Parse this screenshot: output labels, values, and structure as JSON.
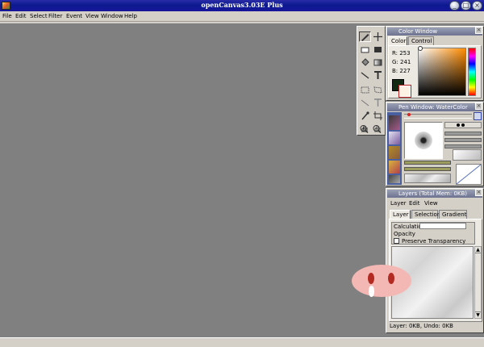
{
  "window": {
    "title": "openCanvas3.03E Plus",
    "controls": [
      "_",
      "□",
      "×"
    ]
  },
  "menu": [
    "File",
    "Edit",
    "Select",
    "Filter",
    "Event",
    "View",
    "Window",
    "Help"
  ],
  "color_window": {
    "title": "Color Window",
    "tabs": [
      "Color",
      "Control"
    ],
    "active_tab": "Color",
    "rgb": {
      "r_label": "R: 253",
      "g_label": "G: 241",
      "b_label": "B: 227"
    },
    "foreground": "#0f2a10",
    "background": "#fdf1e3"
  },
  "pen_window": {
    "title": "Pen Window: WaterColor"
  },
  "layers_window": {
    "title": "Layers (Total Mem: 0KB)",
    "menu": [
      "Layer",
      "Edit",
      "View"
    ],
    "tabs": [
      "Layer",
      "Selection",
      "Gradient"
    ],
    "active_tab": "Layer",
    "calculation_label": "Calculation",
    "opacity_label": "Opacity",
    "preserve_label": "Preserve Transparency",
    "status": "Layer: 0KB, Undo: 0KB"
  },
  "colors": {
    "titlebar": "#0b1a8f",
    "canvas": "#808080",
    "chrome": "#d4d0c8",
    "character": "#f3b8b4",
    "character_eyes": "#b22a22"
  }
}
